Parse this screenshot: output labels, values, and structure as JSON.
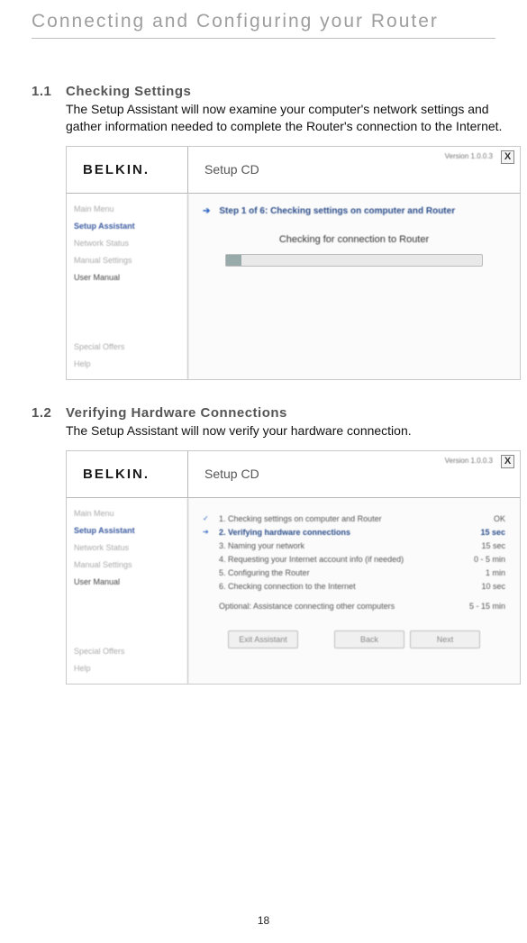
{
  "pageTitle": "Connecting and Configuring your Router",
  "pageNumber": "18",
  "sections": {
    "s1": {
      "num": "1.1",
      "head": "Checking Settings",
      "text": "The Setup Assistant will now examine your computer's network settings and gather information needed to complete the Router's connection to the Internet."
    },
    "s2": {
      "num": "1.2",
      "head": "Verifying Hardware Connections",
      "text": "The Setup Assistant will now verify your hardware connection."
    }
  },
  "card": {
    "logo": "BELKIN.",
    "title": "Setup CD",
    "version": "Version 1.0.0.3",
    "close": "X",
    "sidebar": {
      "i0": "Main Menu",
      "i1": "Setup Assistant",
      "i2": "Network Status",
      "i3": "Manual Settings",
      "i4": "User Manual",
      "i5": "Special Offers",
      "i6": "Help"
    },
    "pane1": {
      "stepline": "Step 1 of 6: Checking settings on computer and Router",
      "checking": "Checking for connection to Router"
    },
    "pane2": {
      "rows": {
        "r1": {
          "label": "1. Checking settings on computer and Router",
          "time": "OK"
        },
        "r2": {
          "label": "2. Verifying hardware connections",
          "time": "15 sec"
        },
        "r3": {
          "label": "3. Naming your network",
          "time": "15 sec"
        },
        "r4": {
          "label": "4. Requesting your Internet account info (if needed)",
          "time": "0 - 5 min"
        },
        "r5": {
          "label": "5. Configuring the Router",
          "time": "1 min"
        },
        "r6": {
          "label": "6. Checking connection to the Internet",
          "time": "10 sec"
        }
      },
      "optional": {
        "label": "Optional: Assistance connecting other computers",
        "time": "5 - 15 min"
      },
      "buttons": {
        "exit": "Exit Assistant",
        "back": "Back",
        "next": "Next"
      }
    }
  }
}
